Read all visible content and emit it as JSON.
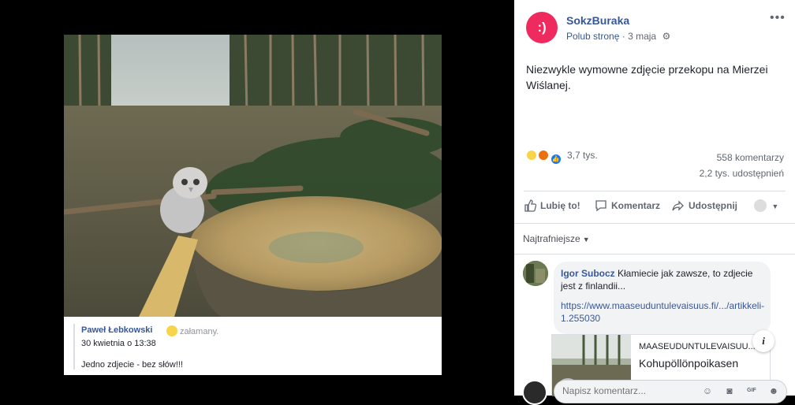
{
  "theater": {
    "shared_post": {
      "author": "Paweł Łebkowski",
      "feeling": "załamany.",
      "date": "30 kwietnia o 13:38",
      "text": "Jedno zdjecie - bez słów!!!"
    }
  },
  "post": {
    "avatar_text": ":)",
    "page_name": "SokzBuraka",
    "like_page_label": "Polub stronę",
    "separator": "·",
    "time": "3 maja",
    "text": "Niezwykle wymowne zdjęcie przekopu na Mierzei Wiślanej.",
    "reactions_count": "3,7 tys.",
    "comments_count": "558 komentarzy",
    "shares_count": "2,2 tys. udostępnień",
    "accent_color": "#ee2a5f"
  },
  "actions": {
    "like_label": "Lubię to!",
    "comment_label": "Komentarz",
    "share_label": "Udostępnij"
  },
  "comments": {
    "sort_label": "Najtrafniejsze",
    "items": [
      {
        "author": "Igor Subocz",
        "text": "Kłamiecie jak zawsze, to zdjecie jest z finlandii...",
        "link": "https://www.maaseuduntulevaisuus.fi/.../artikkeli-1.255030",
        "card_domain": "MAASEUDUNTULEVAISUU...",
        "card_title": "Kohupöllönpoikasen"
      }
    ],
    "write_placeholder": "Napisz komentarz..."
  }
}
